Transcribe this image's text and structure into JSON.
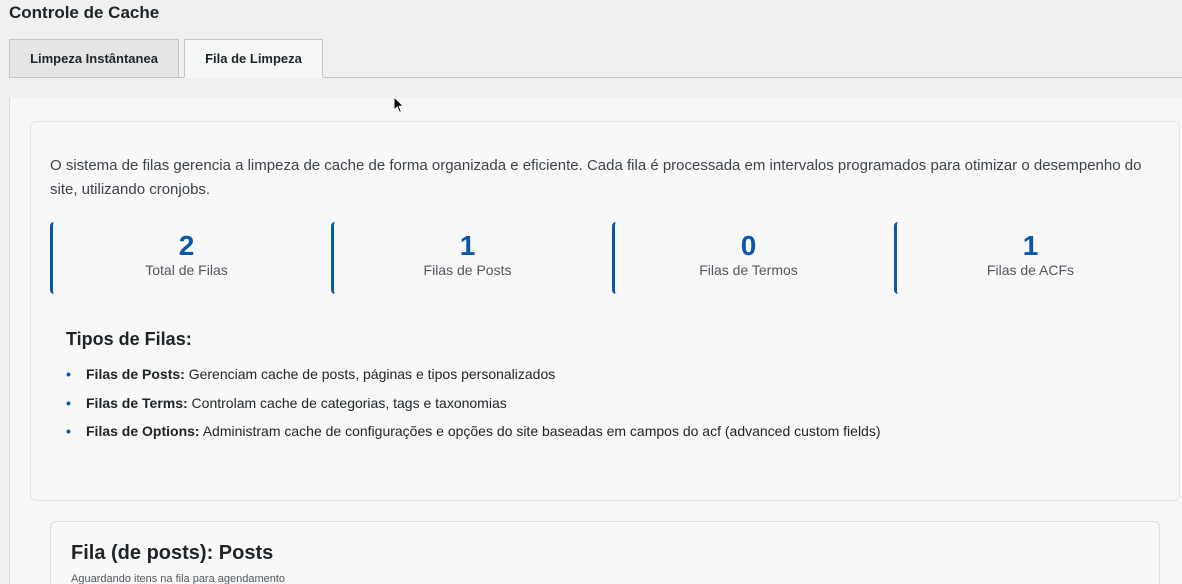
{
  "page": {
    "title": "Controle de Cache"
  },
  "tabs": [
    {
      "label": "Limpeza Instântanea",
      "active": false
    },
    {
      "label": "Fila de Limpeza",
      "active": true
    }
  ],
  "info": {
    "description": "O sistema de filas gerencia a limpeza de cache de forma organizada e eficiente. Cada fila é processada em intervalos programados para otimizar o desempenho do site, utilizando cronjobs."
  },
  "stats": [
    {
      "value": "2",
      "label": "Total de Filas"
    },
    {
      "value": "1",
      "label": "Filas de Posts"
    },
    {
      "value": "0",
      "label": "Filas de Termos"
    },
    {
      "value": "1",
      "label": "Filas de ACFs"
    }
  ],
  "types": {
    "heading": "Tipos de Filas:",
    "items": [
      {
        "term": "Filas de Posts:",
        "text": " Gerenciam cache de posts, páginas e tipos personalizados"
      },
      {
        "term": "Filas de Terms:",
        "text": " Controlam cache de categorias, tags e taxonomias"
      },
      {
        "term": "Filas de Options:",
        "text": " Administram cache de configurações e opções do site baseadas em campos do acf (advanced custom fields)"
      }
    ]
  },
  "queue": {
    "title": "Fila (de posts): Posts",
    "status": "Aguardando itens na fila para agendamento"
  },
  "colors": {
    "accent": "#0a56a8"
  },
  "icons": {
    "cursor": "mouse-pointer-icon",
    "bullet": "bullet-dot-icon"
  }
}
